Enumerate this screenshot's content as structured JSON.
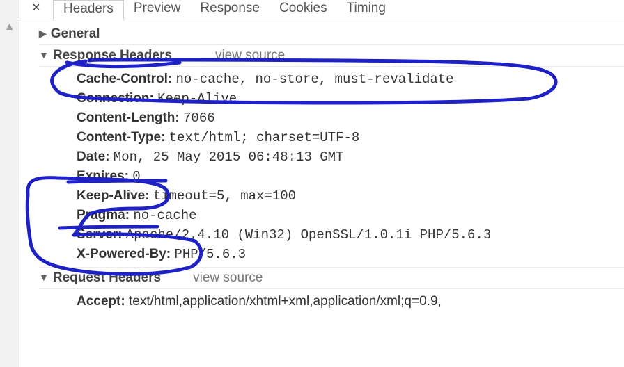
{
  "closeGlyph": "×",
  "tabs": {
    "headers": "Headers",
    "preview": "Preview",
    "response": "Response",
    "cookies": "Cookies",
    "timing": "Timing"
  },
  "sections": {
    "general": {
      "title": "General"
    },
    "responseHeaders": {
      "title": "Response Headers",
      "viewSource": "view source",
      "items": [
        {
          "name": "Cache-Control:",
          "value": "no-cache, no-store, must-revalidate"
        },
        {
          "name": "Connection:",
          "value": "Keep-Alive"
        },
        {
          "name": "Content-Length:",
          "value": "7066"
        },
        {
          "name": "Content-Type:",
          "value": "text/html; charset=UTF-8"
        },
        {
          "name": "Date:",
          "value": "Mon, 25 May 2015 06:48:13 GMT"
        },
        {
          "name": "Expires:",
          "value": "0"
        },
        {
          "name": "Keep-Alive:",
          "value": "timeout=5, max=100"
        },
        {
          "name": "Pragma:",
          "value": "no-cache"
        },
        {
          "name": "Server:",
          "value": "Apache/2.4.10 (Win32) OpenSSL/1.0.1i PHP/5.6.3"
        },
        {
          "name": "X-Powered-By:",
          "value": "PHP/5.6.3"
        }
      ]
    },
    "requestHeaders": {
      "title": "Request Headers",
      "viewSource": "view source",
      "items": [
        {
          "name": "Accept:",
          "value": "text/html,application/xhtml+xml,application/xml;q=0.9,"
        }
      ]
    }
  }
}
